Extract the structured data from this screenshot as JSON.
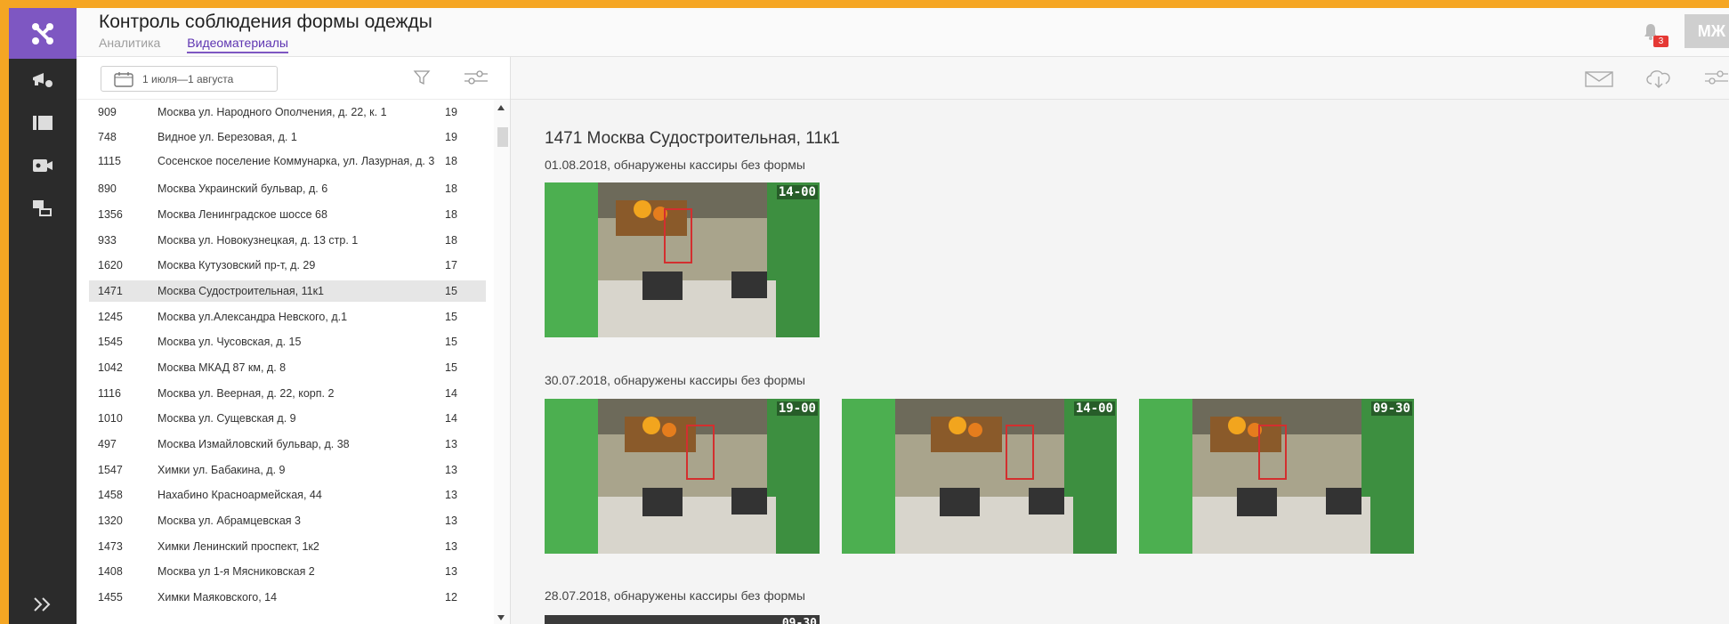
{
  "header": {
    "title": "Контроль соблюдения формы одежды",
    "tabs": [
      {
        "label": "Аналитика",
        "active": false
      },
      {
        "label": "Видеоматериалы",
        "active": true
      }
    ],
    "notifications_count": "3",
    "user_initials": "МЖ"
  },
  "colors": {
    "accent": "#7e57c2",
    "rail": "#2b2b2b",
    "frame": "#f5a623",
    "badge": "#e53935"
  },
  "sidebar": {
    "icons": [
      "logo-icon",
      "megaphone-icon",
      "panels-icon",
      "video-camera-icon",
      "screens-icon"
    ],
    "expand_icon": "double-chevron-right-icon"
  },
  "filters": {
    "date_range": "1 июля—1 августа",
    "filter_icon": "filter-icon",
    "settings_icon": "sliders-icon"
  },
  "stores": [
    {
      "id": "909",
      "address": "Москва ул. Народного Ополчения, д. 22, к. 1",
      "count": "19"
    },
    {
      "id": "748",
      "address": "Видное ул. Березовая, д. 1",
      "count": "19"
    },
    {
      "id": "1115",
      "address": "Сосенское поселение Коммунарка, ул. Лазурная, д. 3",
      "count": "18"
    },
    {
      "id": "890",
      "address": "Москва Украинский бульвар, д. 6",
      "count": "18"
    },
    {
      "id": "1356",
      "address": "Москва Ленинградское шоссе 68",
      "count": "18"
    },
    {
      "id": "933",
      "address": "Москва ул. Новокузнецкая, д. 13 стр. 1",
      "count": "18"
    },
    {
      "id": "1620",
      "address": "Москва Кутузовский пр-т, д. 29",
      "count": "17"
    },
    {
      "id": "1471",
      "address": "Москва Судостроительная, 11к1",
      "count": "15",
      "selected": true
    },
    {
      "id": "1245",
      "address": "Москва ул.Александра Невского, д.1",
      "count": "15"
    },
    {
      "id": "1545",
      "address": "Москва ул. Чусовская, д. 15",
      "count": "15"
    },
    {
      "id": "1042",
      "address": "Москва МКАД 87 км, д. 8",
      "count": "15"
    },
    {
      "id": "1116",
      "address": "Москва ул. Веерная, д. 22, корп. 2",
      "count": "14"
    },
    {
      "id": "1010",
      "address": "Москва ул. Сущевская д. 9",
      "count": "14"
    },
    {
      "id": "497",
      "address": "Москва Измайловский бульвар, д. 38",
      "count": "13"
    },
    {
      "id": "1547",
      "address": "Химки ул. Бабакина, д. 9",
      "count": "13"
    },
    {
      "id": "1458",
      "address": "Нахабино Красноармейская, 44",
      "count": "13"
    },
    {
      "id": "1320",
      "address": "Москва ул. Абрамцевская 3",
      "count": "13"
    },
    {
      "id": "1473",
      "address": "Химки Ленинский проспект, 1к2",
      "count": "13"
    },
    {
      "id": "1408",
      "address": "Москва ул 1-я Мясниковская 2",
      "count": "13"
    },
    {
      "id": "1455",
      "address": "Химки Маяковского, 14",
      "count": "12"
    }
  ],
  "content": {
    "store_title": "1471 Москва Судостроительная, 11к1",
    "toolbar_icons": [
      "mail-icon",
      "cloud-download-icon",
      "sliders-icon"
    ],
    "days": [
      {
        "label": "01.08.2018, обнаружены кассиры без формы",
        "frames": [
          {
            "time": "14-00"
          }
        ]
      },
      {
        "label": "30.07.2018, обнаружены кассиры без формы",
        "frames": [
          {
            "time": "19-00"
          },
          {
            "time": "14-00"
          },
          {
            "time": "09-30"
          }
        ]
      },
      {
        "label": "28.07.2018, обнаружены кассиры без формы",
        "frames": [
          {
            "time": "09-30"
          }
        ]
      }
    ]
  }
}
